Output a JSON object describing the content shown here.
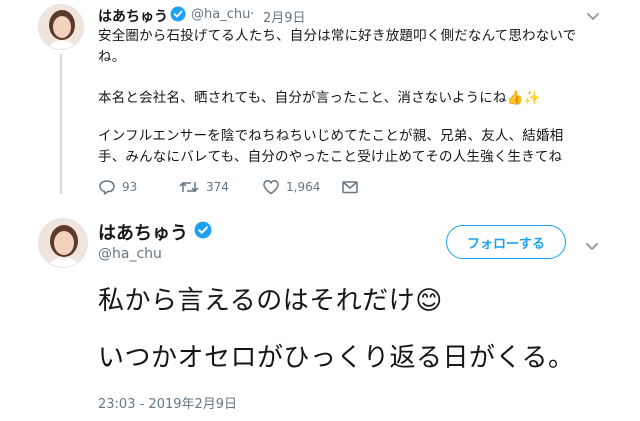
{
  "tweet1": {
    "display_name": "はあちゅう",
    "handle": "@ha_chu",
    "separator": "·",
    "date": "2月9日",
    "lines": [
      "安全圏から石投げてる人たち、自分は常に好き放題叩く側だなんて思わないで",
      "ね。",
      "本名と会社名、晒されても、自分が言ったこと、消さないようにね👍✨",
      "インフルエンサーを陰でねちねちいじめてたことが親、兄弟、友人、結婚相",
      "手、みんなにバレても、自分のやったこと受け止めてその人生強く生きてね"
    ],
    "reply_count": "93",
    "retweet_count": "374",
    "like_count": "1,964"
  },
  "tweet2": {
    "display_name": "はあちゅう",
    "handle": "@ha_chu",
    "follow_label": "フォローする",
    "big_lines": [
      "私から言えるのはそれだけ😊",
      "いつかオセロがひっくり返る日がくる。"
    ],
    "timestamp": "23:03 - 2019年2月9日"
  },
  "colors": {
    "accent": "#1da1f2",
    "muted": "#657786",
    "text": "#14171a"
  }
}
